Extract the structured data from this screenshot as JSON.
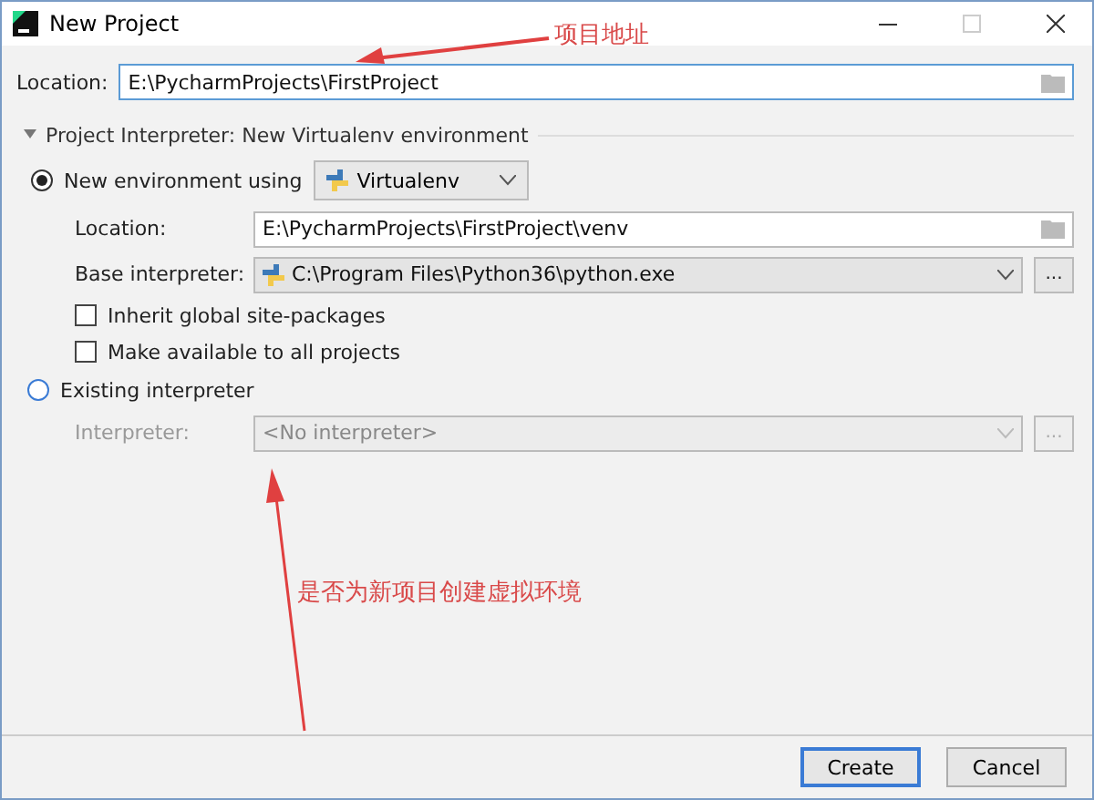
{
  "window": {
    "title": "New Project"
  },
  "location": {
    "label": "Location:",
    "value": "E:\\PycharmProjects\\FirstProject"
  },
  "section": {
    "title": "Project Interpreter: New Virtualenv environment",
    "expanded": true
  },
  "new_environment": {
    "label": "New environment using",
    "selected": true,
    "tool": "Virtualenv",
    "location": {
      "label": "Location:",
      "value": "E:\\PycharmProjects\\FirstProject\\venv"
    },
    "base_interpreter": {
      "label": "Base interpreter:",
      "value": "C:\\Program Files\\Python36\\python.exe",
      "button": "..."
    },
    "options": [
      {
        "label": "Inherit global site-packages",
        "checked": false
      },
      {
        "label": "Make available to all projects",
        "checked": false
      }
    ]
  },
  "existing_interpreter": {
    "label": "Existing interpreter",
    "selected": false,
    "interpreter": {
      "label": "Interpreter:",
      "value": "<No interpreter>",
      "button": "...",
      "disabled": true
    }
  },
  "buttons": [
    {
      "label": "Create",
      "default": true
    },
    {
      "label": "Cancel",
      "default": false
    }
  ],
  "annotations": [
    {
      "text": "项目地址"
    },
    {
      "text": "是否为新项目创建虚拟环境"
    }
  ]
}
